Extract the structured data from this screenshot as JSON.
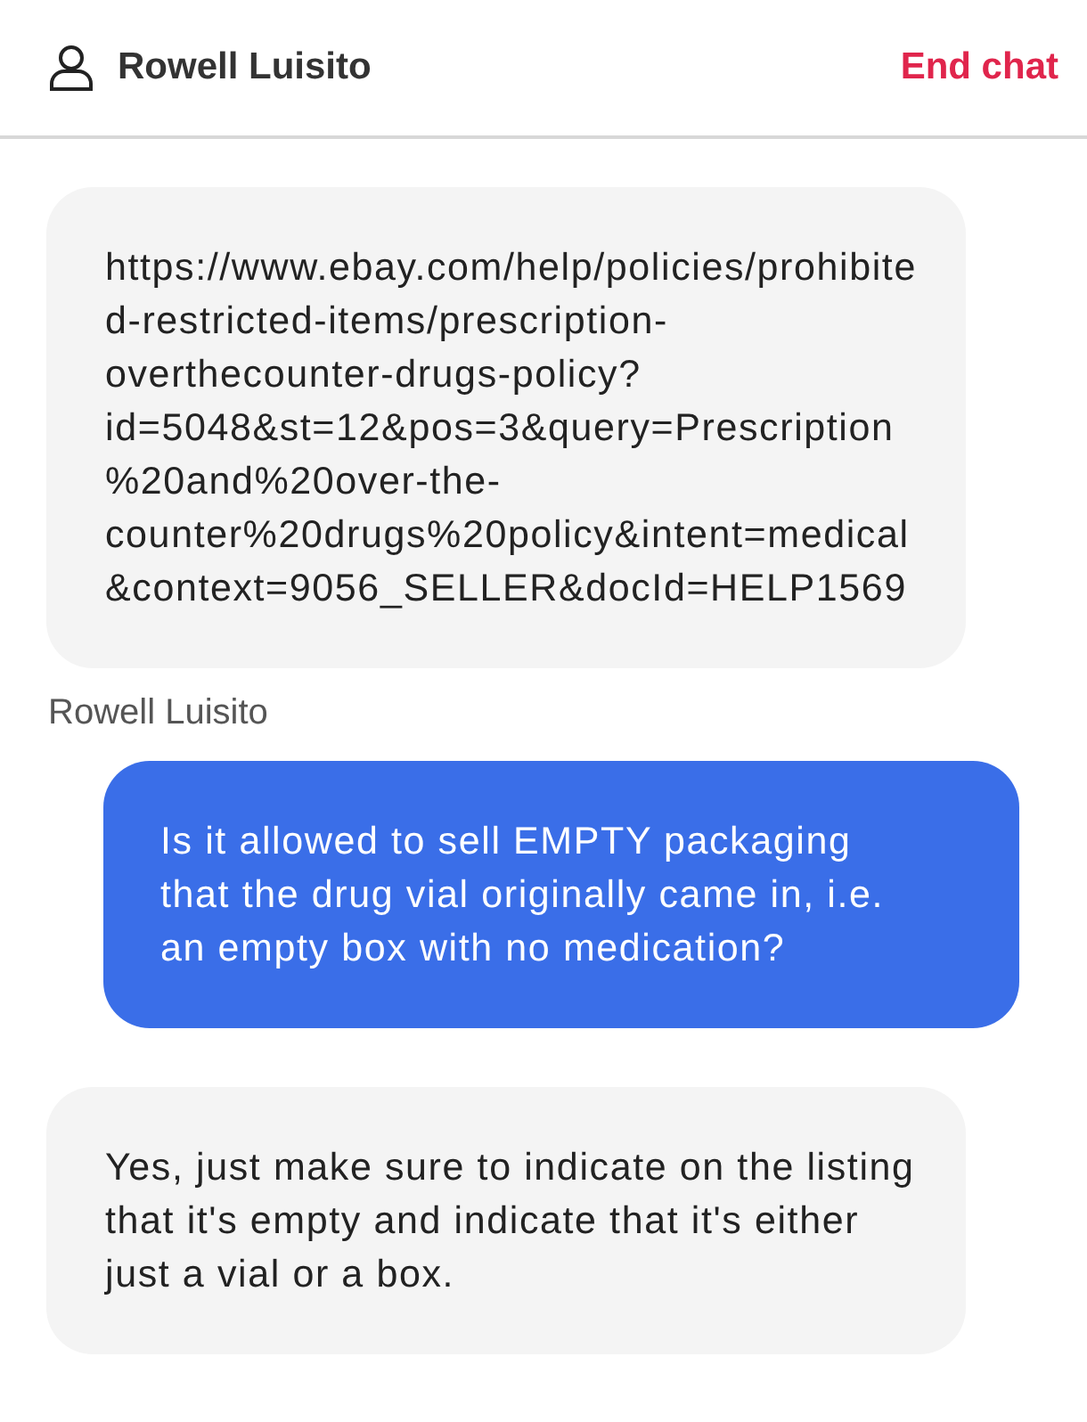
{
  "header": {
    "agent_name": "Rowell Luisito",
    "end_button": "End chat"
  },
  "messages": [
    {
      "kind": "agent",
      "text": "https://www.ebay.com/help/policies/prohibited-restricted-items/prescription-overthecounter-drugs-policy?id=5048&st=12&pos=3&query=Prescription%20and%20over-the-counter%20drugs%20policy&intent=medical&context=9056_SELLER&docId=HELP1569",
      "author": "Rowell Luisito"
    },
    {
      "kind": "user",
      "text": "Is it allowed to sell EMPTY packaging that the drug vial originally came in, i.e. an empty box with no medication?"
    },
    {
      "kind": "agent",
      "text": "Yes, just make sure to indicate on the listing that it's empty and indicate that it's either just a vial or a box."
    }
  ]
}
